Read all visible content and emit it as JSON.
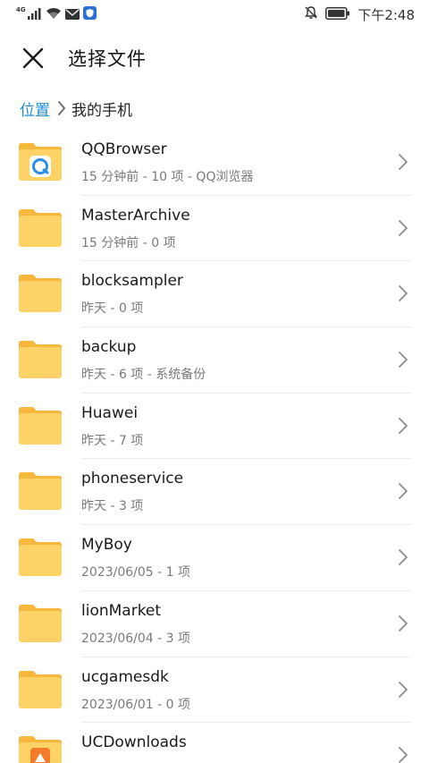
{
  "status_bar": {
    "network": "4G",
    "time": "下午2:48"
  },
  "header": {
    "title": "选择文件",
    "close_icon": "close-icon"
  },
  "breadcrumb": {
    "root": "位置",
    "current": "我的手机"
  },
  "colors": {
    "accent": "#1e8ed8",
    "folder": "#fdd266",
    "folder_tab": "#f6b73c"
  },
  "files": [
    {
      "name": "QQBrowser",
      "meta": "15 分钟前 - 10 项 - QQ浏览器",
      "badge": "qq-browser-logo"
    },
    {
      "name": "MasterArchive",
      "meta": "15 分钟前 - 0 项"
    },
    {
      "name": "blocksampler",
      "meta": "昨天 - 0 项"
    },
    {
      "name": "backup",
      "meta": "昨天 - 6 项 - 系统备份"
    },
    {
      "name": "Huawei",
      "meta": "昨天 - 7 项"
    },
    {
      "name": "phoneservice",
      "meta": "昨天 - 3 项"
    },
    {
      "name": "MyBoy",
      "meta": "2023/06/05 - 1 项"
    },
    {
      "name": "lionMarket",
      "meta": "2023/06/04 - 3 项"
    },
    {
      "name": "ucgamesdk",
      "meta": "2023/06/01 - 0 项"
    },
    {
      "name": "UCDownloads",
      "meta": "",
      "badge": "uc-downloads-logo"
    }
  ]
}
